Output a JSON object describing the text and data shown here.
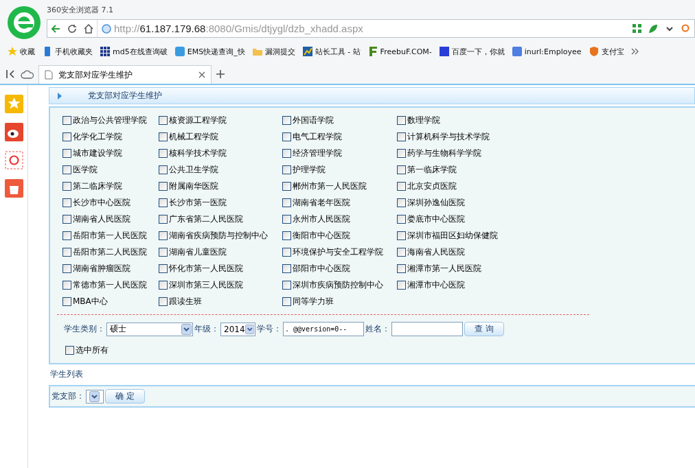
{
  "window": {
    "title": "360安全浏览器 7.1"
  },
  "address_bar": {
    "scheme": "http://",
    "host": "61.187.179.68",
    "path": ":8080/Gmis/dtjygl/dzb_xhadd.aspx"
  },
  "bookmarks": [
    {
      "label": "收藏",
      "kind": "favorites"
    },
    {
      "label": "手机收藏夹",
      "kind": "phone"
    },
    {
      "label": "md5在线查询破",
      "kind": "grid"
    },
    {
      "label": "EMS快递查询_快",
      "kind": "app"
    },
    {
      "label": "漏洞提交",
      "kind": "folder"
    },
    {
      "label": "站长工具 - 站",
      "kind": "chart"
    },
    {
      "label": "FreebuF.COM-",
      "kind": "f"
    },
    {
      "label": "百度一下，你就",
      "kind": "paw"
    },
    {
      "label": "inurl:Employee",
      "kind": "g"
    },
    {
      "label": "支付宝",
      "kind": "shield"
    }
  ],
  "tabs": [
    {
      "label": "党支部对应学生维护",
      "selected": true
    }
  ],
  "page": {
    "header": "党支部对应学生维护",
    "colleges": [
      {
        "label": "政治与公共管理学院",
        "checked": false
      },
      {
        "label": "核资源工程学院",
        "checked": false
      },
      {
        "label": "外国语学院",
        "checked": false
      },
      {
        "label": "数理学院",
        "checked": false
      },
      {
        "label": "化学化工学院",
        "checked": false
      },
      {
        "label": "机械工程学院",
        "checked": false
      },
      {
        "label": "电气工程学院",
        "checked": false
      },
      {
        "label": "计算机科学与技术学院",
        "checked": false
      },
      {
        "label": "城市建设学院",
        "checked": false
      },
      {
        "label": "核科学技术学院",
        "checked": false
      },
      {
        "label": "经济管理学院",
        "checked": false
      },
      {
        "label": "药学与生物科学学院",
        "checked": false
      },
      {
        "label": "医学院",
        "checked": false
      },
      {
        "label": "公共卫生学院",
        "checked": false
      },
      {
        "label": "护理学院",
        "checked": false
      },
      {
        "label": "第一临床学院",
        "checked": false
      },
      {
        "label": "第二临床学院",
        "checked": false
      },
      {
        "label": "附属南华医院",
        "checked": false
      },
      {
        "label": "郴州市第一人民医院",
        "checked": false
      },
      {
        "label": "北京安贞医院",
        "checked": false
      },
      {
        "label": "长沙市中心医院",
        "checked": false
      },
      {
        "label": "长沙市第一医院",
        "checked": false
      },
      {
        "label": "湖南省老年医院",
        "checked": false
      },
      {
        "label": "深圳孙逸仙医院",
        "checked": false
      },
      {
        "label": "湖南省人民医院",
        "checked": false
      },
      {
        "label": "广东省第二人民医院",
        "checked": false
      },
      {
        "label": "永州市人民医院",
        "checked": false
      },
      {
        "label": "娄底市中心医院",
        "checked": false
      },
      {
        "label": "岳阳市第一人民医院",
        "checked": false
      },
      {
        "label": "湖南省疾病预防与控制中心",
        "checked": false
      },
      {
        "label": "衡阳市中心医院",
        "checked": false
      },
      {
        "label": "深圳市福田区妇幼保健院",
        "checked": false
      },
      {
        "label": "岳阳市第二人民医院",
        "checked": false
      },
      {
        "label": "湖南省儿童医院",
        "checked": false
      },
      {
        "label": "环境保护与安全工程学院",
        "checked": false
      },
      {
        "label": "海南省人民医院",
        "checked": false
      },
      {
        "label": "湖南省肿瘤医院",
        "checked": false
      },
      {
        "label": "怀化市第一人民医院",
        "checked": false
      },
      {
        "label": "邵阳市中心医院",
        "checked": false
      },
      {
        "label": "湘潭市第一人民医院",
        "checked": false
      },
      {
        "label": "常德市第一人民医院",
        "checked": false
      },
      {
        "label": "深圳市第三人民医院",
        "checked": false
      },
      {
        "label": "深圳市疾病预防控制中心",
        "checked": false
      },
      {
        "label": "湘潭市中心医院",
        "checked": false
      },
      {
        "label": "MBA中心",
        "checked": false
      },
      {
        "label": "跟读生班",
        "checked": false
      },
      {
        "label": "同等学力班",
        "checked": false
      }
    ],
    "filters": {
      "category_label": "学生类别：",
      "category_value": "硕士",
      "grade_label": "年级：",
      "grade_value": "2014",
      "id_label": "学号：",
      "id_value": ". @@version=0--",
      "name_label": "姓名：",
      "search_button": "查 询"
    },
    "select_all": {
      "label": "选中所有",
      "checked": false
    },
    "list_title": "学生列表",
    "branch_label": "党支部：",
    "confirm_button": "确 定"
  }
}
